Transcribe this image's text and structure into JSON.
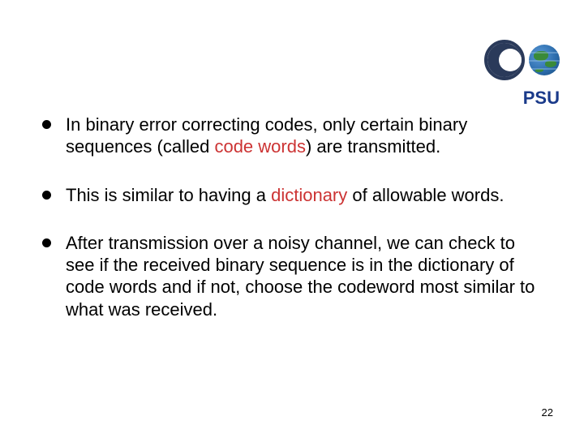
{
  "logo": {
    "label": "PSU",
    "crescent_color": "#2a3a5a",
    "globe_ocean": "#2a6aaa",
    "globe_land": "#3a8a3a"
  },
  "bullets": [
    {
      "segments": [
        {
          "text": "In binary error correcting codes, only certain binary sequences (called ",
          "highlight": false
        },
        {
          "text": "code words",
          "highlight": true
        },
        {
          "text": ") are transmitted.",
          "highlight": false
        }
      ]
    },
    {
      "segments": [
        {
          "text": "This is similar to having a ",
          "highlight": false
        },
        {
          "text": "dictionary",
          "highlight": true
        },
        {
          "text": " of allowable words.",
          "highlight": false
        }
      ]
    },
    {
      "segments": [
        {
          "text": "After transmission over a noisy channel, we can check to see if the received binary sequence is in the dictionary of code words and if not, choose the codeword most similar to what was received.",
          "highlight": false
        }
      ]
    }
  ],
  "page_number": "22"
}
